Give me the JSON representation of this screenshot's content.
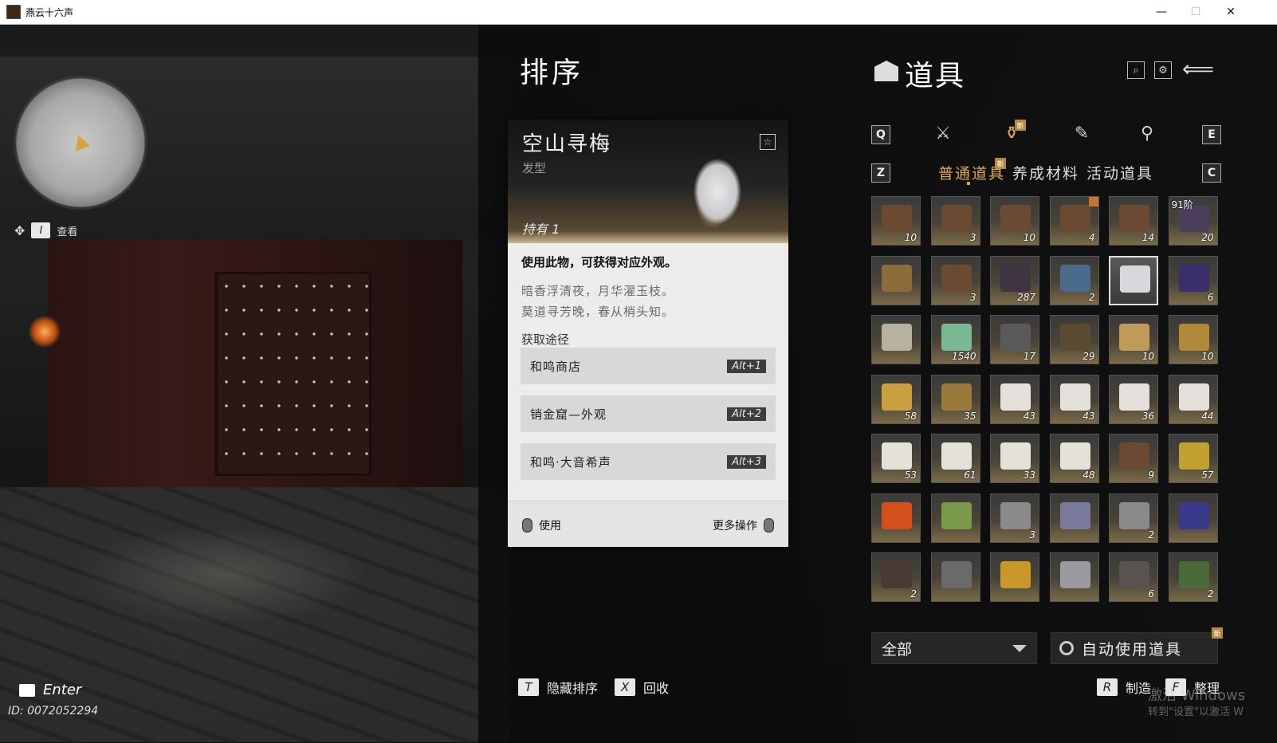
{
  "window": {
    "title": "燕云十六声",
    "minimize": "—",
    "maximize": "☐",
    "close": "✕"
  },
  "hud": {
    "view_key": "I",
    "view_label": "查看",
    "chat_key": "Enter",
    "player_id": "ID: 0072052294"
  },
  "sort_panel": {
    "title": "排序",
    "hide_key": "T",
    "hide_label": "隐藏排序",
    "recycle_key": "X",
    "recycle_label": "回收"
  },
  "item_card": {
    "name": "空山寻梅",
    "type": "发型",
    "owned": "持有 1",
    "description": "使用此物，可获得对应外观。",
    "poem_line1": "暗香浮清夜，月华濯玉枝。",
    "poem_line2": "莫道寻芳晚，春从梢头知。",
    "source_label": "获取途径",
    "sources": [
      {
        "label": "和鸣商店",
        "shortcut": "Alt+1"
      },
      {
        "label": "销金窟—外观",
        "shortcut": "Alt+2"
      },
      {
        "label": "和鸣·大音希声",
        "shortcut": "Alt+3"
      }
    ],
    "use_label": "使用",
    "more_label": "更多操作"
  },
  "inventory": {
    "title": "道具",
    "prev_tab_key": "Q",
    "next_tab_key": "E",
    "prev_sub_key": "Z",
    "next_sub_key": "C",
    "new_badge": "新",
    "subtabs": [
      "普通道具",
      "养成材料",
      "活动道具"
    ],
    "filter_value": "全部",
    "auto_use_label": "自动使用道具",
    "craft_key": "R",
    "craft_label": "制造",
    "sort_key": "F",
    "sort_label": "整理",
    "items": [
      {
        "color": "#6b4a32",
        "count": "10"
      },
      {
        "color": "#6b4a32",
        "count": "3"
      },
      {
        "color": "#6b4a32",
        "count": "10"
      },
      {
        "color": "#6b4a32",
        "count": "4",
        "badge": true
      },
      {
        "color": "#6b4a32",
        "count": "14"
      },
      {
        "color": "#4b3e5a",
        "count": "20",
        "tier": "91阶"
      },
      {
        "color": "#8a6d38",
        "count": ""
      },
      {
        "color": "#6b4a32",
        "count": "3"
      },
      {
        "color": "#3e3540",
        "count": "287"
      },
      {
        "color": "#4a6a8a",
        "count": "2"
      },
      {
        "color": "#d8d8dc",
        "count": "",
        "selected": true
      },
      {
        "color": "#3a2f6a",
        "count": "6"
      },
      {
        "color": "#b8b0a0",
        "count": ""
      },
      {
        "color": "#7ab894",
        "count": "1540"
      },
      {
        "color": "#5a5a5a",
        "count": "17"
      },
      {
        "color": "#5a4a32",
        "count": "29"
      },
      {
        "color": "#c09a58",
        "count": "10"
      },
      {
        "color": "#b08a3a",
        "count": "10"
      },
      {
        "color": "#c8a040",
        "count": "58"
      },
      {
        "color": "#9a7a3a",
        "count": "35"
      },
      {
        "color": "#e4e0da",
        "count": "43"
      },
      {
        "color": "#e4e0da",
        "count": "43"
      },
      {
        "color": "#e4e0da",
        "count": "36"
      },
      {
        "color": "#e4e0da",
        "count": "44"
      },
      {
        "color": "#e4e0da",
        "count": "53"
      },
      {
        "color": "#e4e0da",
        "count": "61"
      },
      {
        "color": "#e4e0da",
        "count": "33"
      },
      {
        "color": "#e4e0da",
        "count": "48"
      },
      {
        "color": "#6b4a32",
        "count": "9"
      },
      {
        "color": "#c0a030",
        "count": "57"
      },
      {
        "color": "#d2501e",
        "count": ""
      },
      {
        "color": "#7a9a4a",
        "count": ""
      },
      {
        "color": "#8a8a8a",
        "count": "3"
      },
      {
        "color": "#7a7a9a",
        "count": ""
      },
      {
        "color": "#8a8a8a",
        "count": "2"
      },
      {
        "color": "#3a3a8a",
        "count": ""
      },
      {
        "color": "#4a3a34",
        "count": "2"
      },
      {
        "color": "#6a6a6a",
        "count": ""
      },
      {
        "color": "#c8982a",
        "count": ""
      },
      {
        "color": "#9a9aa0",
        "count": ""
      },
      {
        "color": "#5a5450",
        "count": "6"
      },
      {
        "color": "#4a6a3a",
        "count": "2"
      }
    ]
  },
  "colors": {
    "accent": "#e0a84a",
    "card_bg": "#ececec",
    "panel_bg": "#262626"
  },
  "watermark": {
    "line1": "激活 Windows",
    "line2": "转到\"设置\"以激活 W"
  }
}
